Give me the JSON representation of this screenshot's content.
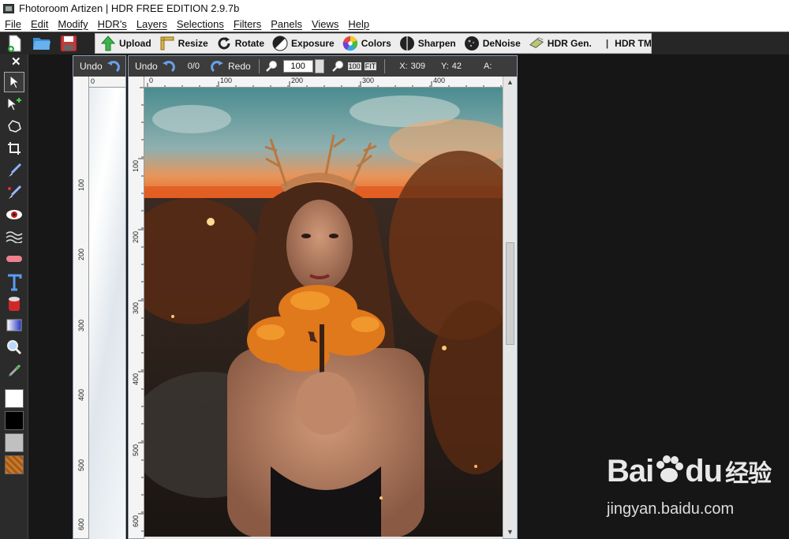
{
  "window": {
    "title": "Fhotoroom Artizen | HDR FREE EDITION 2.9.7b"
  },
  "menu": [
    "File",
    "Edit",
    "Modify",
    "HDR's",
    "Layers",
    "Selections",
    "Filters",
    "Panels",
    "Views",
    "Help"
  ],
  "toolbar": {
    "upload": "Upload",
    "resize": "Resize",
    "rotate": "Rotate",
    "exposure": "Exposure",
    "colors": "Colors",
    "sharpen": "Sharpen",
    "denoise": "DeNoise",
    "hdr_gen": "HDR Gen.",
    "separator": "|",
    "hdr_tm": "HDR TM"
  },
  "left_panel": {
    "close": "✕"
  },
  "doc_back": {
    "undo": "Undo",
    "ruler_top": [
      "0"
    ],
    "ruler_left": [
      "100",
      "200",
      "300",
      "400",
      "500",
      "600"
    ]
  },
  "doc_front": {
    "undo": "Undo",
    "history": "0/0",
    "redo": "Redo",
    "zoom_value": "100",
    "zoom_fit_label": "100",
    "fit_label": "FIT",
    "x_label": "X:",
    "x_value": "309",
    "y_label": "Y:",
    "y_value": "42",
    "a_label": "A:",
    "ruler_top": [
      "0",
      "100",
      "200",
      "300",
      "400"
    ],
    "ruler_left": [
      "100",
      "200",
      "300",
      "400",
      "500",
      "600"
    ]
  },
  "watermark": {
    "main": "Bai",
    "paw": "du",
    "cn": "经验",
    "sub": "jingyan.baidu.com"
  },
  "colors": {
    "fg_swatch": "#ffffff",
    "bg_swatch": "#000000",
    "gray_swatch": "#c0c0c0"
  }
}
